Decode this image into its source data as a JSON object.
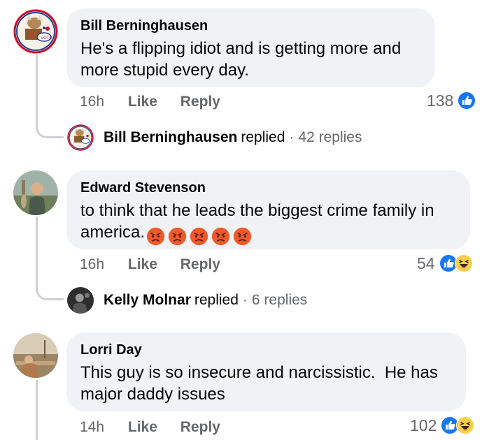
{
  "comments": [
    {
      "author": "Bill Berninghausen",
      "text": "He's a flipping idiot and is getting more and more stupid every day.",
      "time": "16h",
      "like_label": "Like",
      "reply_label": "Reply",
      "reaction_count": "138",
      "reactions": [
        "like-icon"
      ],
      "replies": {
        "name": "Bill Berninghausen",
        "verb": "replied",
        "dot": "·",
        "count": "42 replies"
      }
    },
    {
      "author": "Edward Stevenson",
      "text": "to think that he leads the biggest crime family in america.",
      "emojis": [
        "angry-face",
        "angry-face",
        "angry-face",
        "angry-face",
        "angry-face"
      ],
      "time": "16h",
      "like_label": "Like",
      "reply_label": "Reply",
      "reaction_count": "54",
      "reactions": [
        "like-icon",
        "haha-icon"
      ],
      "replies": {
        "name": "Kelly Molnar",
        "verb": "replied",
        "dot": "·",
        "count": "6 replies"
      }
    },
    {
      "author": "Lorri Day",
      "text": "This guy is so insecure and narcissistic.  He has major daddy issues",
      "time": "14h",
      "like_label": "Like",
      "reply_label": "Reply",
      "reaction_count": "102",
      "reactions": [
        "like-icon",
        "haha-icon"
      ]
    }
  ],
  "colors": {
    "bubble": "#f0f2f5",
    "meta": "#65676b",
    "like_blue": "#1877f2",
    "thread_line": "#ced0d4"
  }
}
